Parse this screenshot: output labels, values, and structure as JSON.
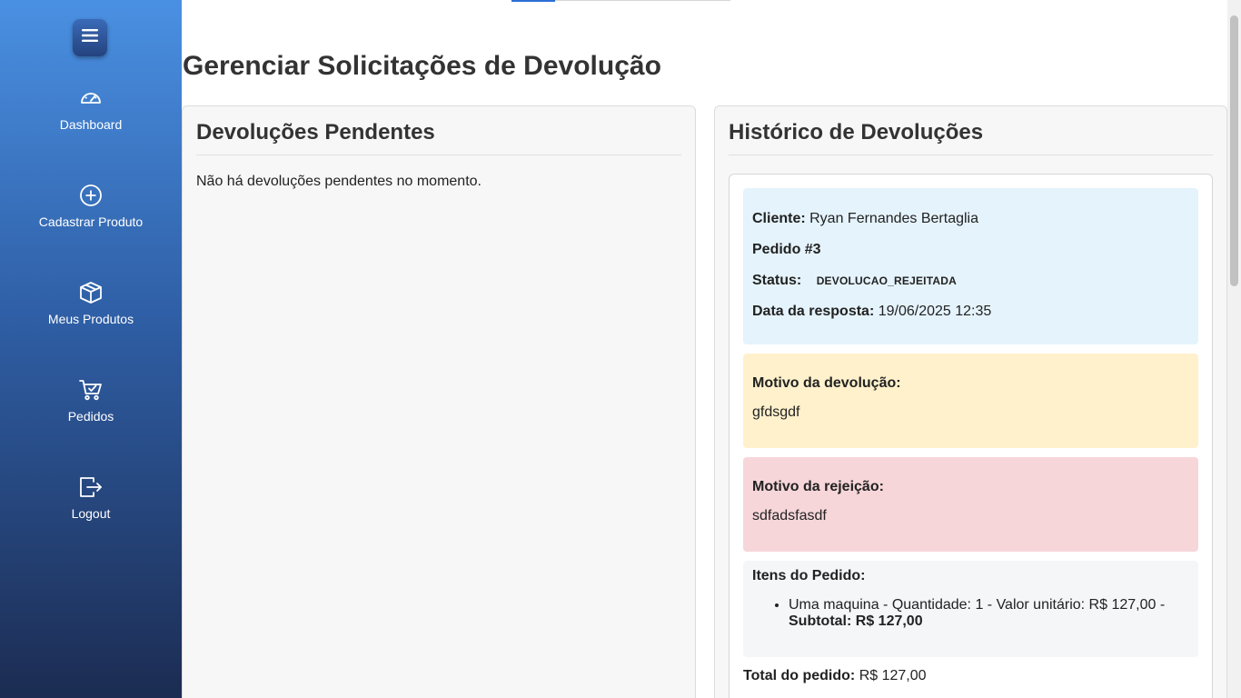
{
  "sidebar": {
    "items": [
      {
        "label": "Dashboard",
        "icon": "dashboard-icon"
      },
      {
        "label": "Cadastrar Produto",
        "icon": "plus-circle-icon"
      },
      {
        "label": "Meus Produtos",
        "icon": "box-icon"
      },
      {
        "label": "Pedidos",
        "icon": "cart-check-icon"
      },
      {
        "label": "Logout",
        "icon": "logout-icon"
      }
    ]
  },
  "page": {
    "title": "Gerenciar Solicitações de Devolução"
  },
  "pending": {
    "title": "Devoluções Pendentes",
    "empty_message": "Não há devoluções pendentes no momento."
  },
  "history": {
    "title": "Histórico de Devoluções",
    "entry": {
      "client_label": "Cliente:",
      "client_value": "Ryan Fernandes Bertaglia",
      "order_label": "Pedido #3",
      "status_label": "Status:",
      "status_value": "DEVOLUCAO_REJEITADA",
      "date_label": "Data da resposta:",
      "date_value": "19/06/2025 12:35",
      "reason_title": "Motivo da devolução:",
      "reason_text": "gfdsgdf",
      "reject_title": "Motivo da rejeição:",
      "reject_text": "sdfadsfasdf",
      "items_title": "Itens do Pedido:",
      "item_text": "Uma maquina - Quantidade: 1 - Valor unitário: R$ 127,00 -",
      "item_subtotal": "Subtotal: R$ 127,00",
      "total_label": "Total do pedido:",
      "total_value": "R$ 127,00"
    }
  },
  "colors": {
    "sidebar_top": "#4a90e2",
    "sidebar_bottom": "#1c2c52",
    "info_bg": "#e5f3fc",
    "reason_bg": "#fff1cc",
    "reject_bg": "#f7d6da"
  }
}
